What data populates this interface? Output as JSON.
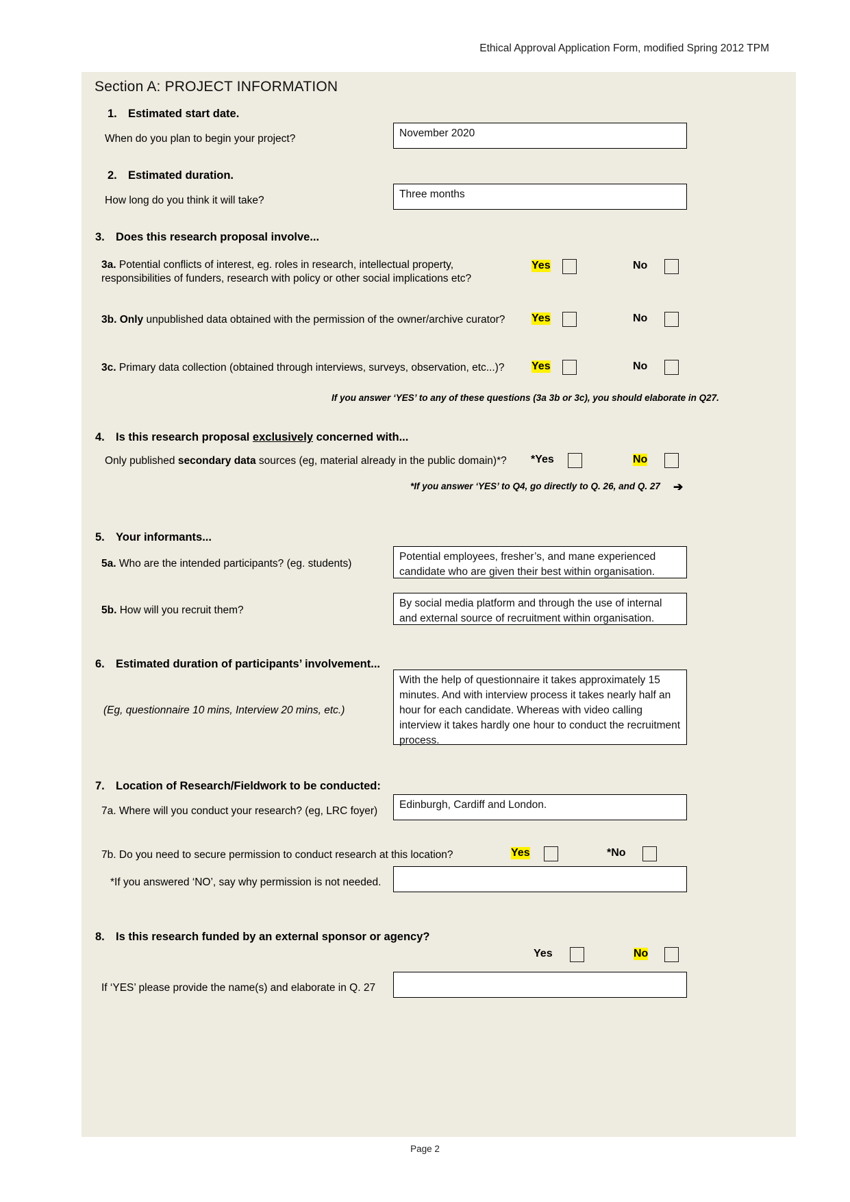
{
  "header": {
    "text": "Ethical Approval Application Form, modified Spring 2012  TPM"
  },
  "footer": {
    "page_label": "Page 2"
  },
  "section": {
    "title": "Section A: PROJECT INFORMATION"
  },
  "colors": {
    "page_background": "#FFFFFF",
    "form_background": "#EEEBE0",
    "highlight": "#FFF100",
    "field_background": "#FFFFFF",
    "border": "#000000"
  },
  "questions": {
    "q1": {
      "number": "1.",
      "title": "Estimated start date.",
      "prompt": "When do you plan to begin your project?",
      "answer": "November 2020"
    },
    "q2": {
      "number": "2.",
      "title": "Estimated duration.",
      "prompt": "How long do you think it will take?",
      "answer": "Three months"
    },
    "q3": {
      "number": "3.",
      "title": "Does this research proposal involve...",
      "a": {
        "label": "3a.",
        "line1": "Potential conflicts of interest, eg. roles in research, intellectual property,",
        "line2": "responsibilities of funders, research with policy or other social implications etc?",
        "yes": "Yes",
        "no": "No",
        "yes_highlighted": true,
        "no_highlighted": false,
        "yes_checked": false,
        "no_checked": false
      },
      "b": {
        "label": "3b.",
        "bold_word": "Only",
        "text": "unpublished data obtained with the permission of the owner/archive curator?",
        "yes": "Yes",
        "no": "No",
        "yes_highlighted": true,
        "no_highlighted": false,
        "yes_checked": false,
        "no_checked": false
      },
      "c": {
        "label": "3c.",
        "text": "Primary data collection (obtained through interviews, surveys, observation, etc...)?",
        "yes": "Yes",
        "no": "No",
        "yes_highlighted": true,
        "no_highlighted": false,
        "yes_checked": false,
        "no_checked": false
      },
      "note": "If you answer ‘YES’ to any of these questions (3a 3b or 3c), you should elaborate in Q27."
    },
    "q4": {
      "number": "4.",
      "title_before": "Is this research proposal ",
      "title_underlined": "exclusively",
      "title_after": " concerned with...",
      "prompt_pre": "Only published ",
      "prompt_bold": "secondary data",
      "prompt_post": " sources (eg, material already in the public domain)*?",
      "yes": "*Yes",
      "no": "No",
      "yes_highlighted": false,
      "no_highlighted": true,
      "note": "*If you answer ‘YES’ to Q4, go directly to Q. 26, and Q. 27",
      "note_arrow": "➔"
    },
    "q5": {
      "number": "5.",
      "title": "Your informants...",
      "a": {
        "label": "5a.",
        "prompt": "Who are the intended participants?  (eg. students)",
        "answer": "Potential employees, fresher’s, and mane experienced candidate who are given their best within organisation."
      },
      "b": {
        "label": "5b.",
        "prompt": "How will you recruit them?",
        "answer": "By social media platform and through the use of internal and external source of recruitment within organisation."
      }
    },
    "q6": {
      "number": "6.",
      "title": "Estimated duration of participants’ involvement...",
      "hint": "(Eg, questionnaire 10 mins, Interview 20 mins, etc.)",
      "answer": "With the help of questionnaire it takes approximately 15 minutes. And with interview process it takes nearly half an hour for each candidate. Whereas with video calling interview it takes hardly one hour to conduct the recruitment process."
    },
    "q7": {
      "number": "7.",
      "title": "Location of Research/Fieldwork to be conducted:",
      "a": {
        "label": "7a.",
        "prompt": "Where will you conduct your research?  (eg, LRC foyer)",
        "answer": "Edinburgh, Cardiff and London."
      },
      "b": {
        "label": "7b.",
        "prompt": "Do you need to secure permission to conduct research at this location?",
        "yes": "Yes",
        "no": "*No",
        "yes_highlighted": true,
        "no_highlighted": false,
        "followup_prompt": "*If you answered ‘NO’, say why permission is not needed.",
        "followup_answer": ""
      }
    },
    "q8": {
      "number": "8.",
      "title": "Is this research funded by an external sponsor or agency?",
      "yes": "Yes",
      "no": "No",
      "yes_highlighted": false,
      "no_highlighted": true,
      "followup_prompt": "If ‘YES’ please provide the name(s) and elaborate in Q. 27",
      "followup_answer": ""
    }
  }
}
